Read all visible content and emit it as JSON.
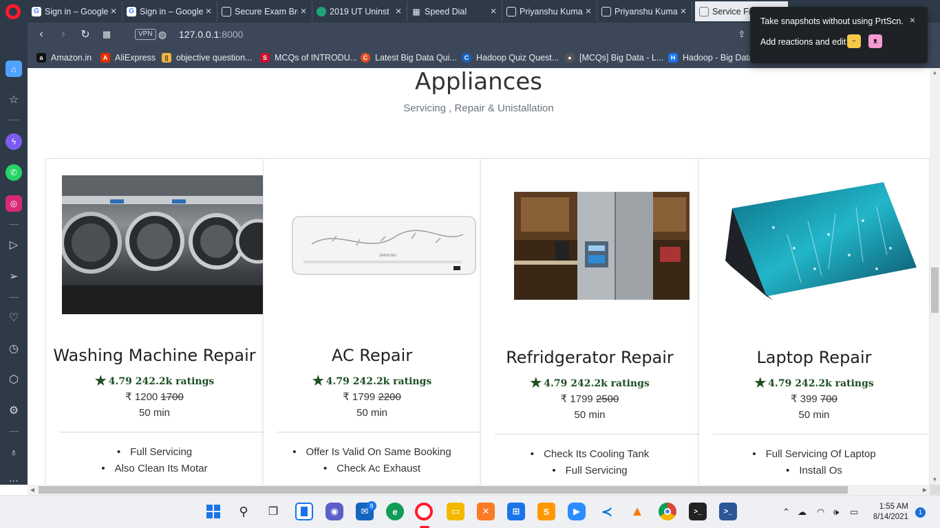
{
  "tabs": [
    {
      "title": "Sign in – Google",
      "favicon": "google-icon"
    },
    {
      "title": "Sign in – Google",
      "favicon": "google-icon"
    },
    {
      "title": "Secure Exam Bro",
      "favicon": "page-icon"
    },
    {
      "title": "2019 UT Uninst",
      "favicon": "teal-circle-icon"
    },
    {
      "title": "Speed Dial",
      "favicon": "grid-icon"
    },
    {
      "title": "Priyanshu Kuma",
      "favicon": "page-icon"
    },
    {
      "title": "Priyanshu Kuma",
      "favicon": "page-icon"
    },
    {
      "title": "Service Fin",
      "favicon": "page-icon"
    }
  ],
  "address": {
    "host": "127.0.0.1",
    "port": ":8000",
    "vpn_label": "VPN"
  },
  "bookmarks": [
    {
      "label": "Amazon.in",
      "icon_text": "a",
      "color": "#111111"
    },
    {
      "label": "AliExpress",
      "icon_text": "A",
      "color": "#e62e04"
    },
    {
      "label": "objective question...",
      "icon_text": "||",
      "color": "#f3b33d"
    },
    {
      "label": "MCQs of INTRODU...",
      "icon_text": "S",
      "color": "#c8102e"
    },
    {
      "label": "Latest Big Data Qui...",
      "icon_text": "C",
      "color": "#e84a1f"
    },
    {
      "label": "Hadoop Quiz Quest...",
      "icon_text": "C",
      "color": "#1565c0"
    },
    {
      "label": "[MCQs] Big Data - L...",
      "icon_text": "●",
      "color": "#555555"
    },
    {
      "label": "Hadoop - Big Data",
      "icon_text": "H",
      "color": "#1a73e8"
    }
  ],
  "popup": {
    "line1": "Take snapshots without using PrtScn.",
    "line2": "Add reactions and edit",
    "close": "×"
  },
  "page": {
    "title": "Appliances",
    "subtitle": "Servicing , Repair & Unistallation"
  },
  "cards": [
    {
      "title": "Washing Machine Repair",
      "rating": "4.79 242.2k ratings",
      "price": "₹ 1200",
      "old_price": "1700",
      "duration": "50 min",
      "features": [
        "Full Servicing",
        "Also Clean Its Motar"
      ]
    },
    {
      "title": "AC Repair",
      "rating": "4.79 242.2k ratings",
      "price": "₹ 1799",
      "old_price": "2200",
      "duration": "50 min",
      "features": [
        "Offer Is Valid On Same Booking",
        "Check Ac Exhaust"
      ]
    },
    {
      "title": "Refridgerator Repair",
      "rating": "4.79 242.2k ratings",
      "price": "₹ 1799",
      "old_price": "2500",
      "duration": "50 min",
      "features": [
        "Check Its Cooling Tank",
        "Full Servicing"
      ]
    },
    {
      "title": "Laptop Repair",
      "rating": "4.79 242.2k ratings",
      "price": "₹ 399",
      "old_price": "700",
      "duration": "50 min",
      "features": [
        "Full Servicing Of Laptop",
        "Install Os"
      ]
    }
  ],
  "taskbar": {
    "mail_badge": "8",
    "time": "1:55 AM",
    "date": "8/14/2021",
    "notification_count": "1"
  },
  "colors": {
    "accent_star": "#1f4f22",
    "opera_red": "#ff1b2d",
    "browser_chrome": "#3c4859"
  }
}
